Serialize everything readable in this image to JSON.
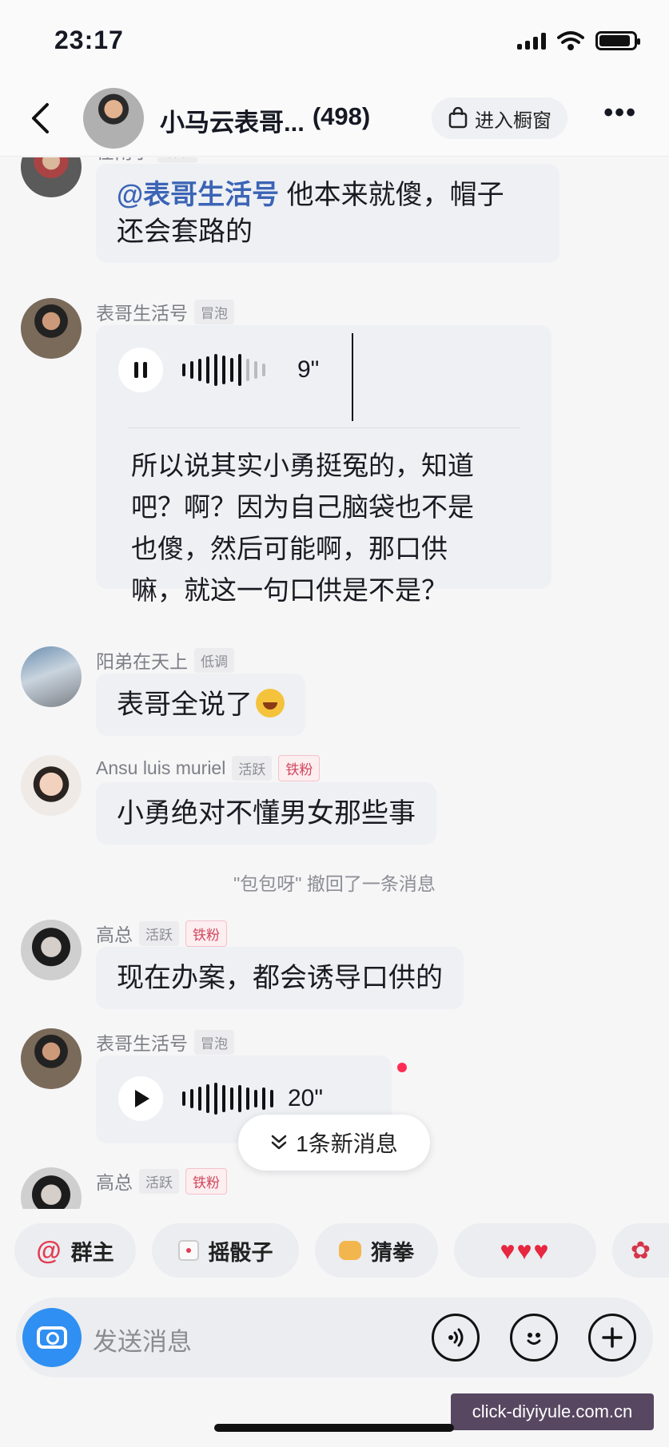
{
  "status_bar": {
    "time": "23:17"
  },
  "header": {
    "title": "小马云表哥...",
    "member_count": "(498)",
    "shop_label": "进入橱窗"
  },
  "messages": [
    {
      "name": "在南宁",
      "tags": [
        "活跃"
      ],
      "mention": "@表哥生活号",
      "text_line1": "他本来就傻，帽子",
      "text_line2": "还会套路的"
    },
    {
      "name": "表哥生活号",
      "tags": [
        "冒泡"
      ],
      "voice_duration": "9\"",
      "transcript": [
        "所以说其实小勇挺冤的，知道",
        "吧？啊？因为自己脑袋也不是",
        "也傻，然后可能啊，那口供",
        "嘛，就这一句口供是不是？"
      ]
    },
    {
      "name": "阳弟在天上",
      "tags": [
        "低调"
      ],
      "text": "表哥全说了"
    },
    {
      "name": "Ansu luis muriel",
      "tags": [
        "活跃",
        "铁粉"
      ],
      "text": "小勇绝对不懂男女那些事"
    },
    {
      "name": "高总",
      "tags": [
        "活跃",
        "铁粉"
      ],
      "text": "现在办案，都会诱导口供的"
    },
    {
      "name": "表哥生活号",
      "tags": [
        "冒泡"
      ],
      "voice_duration": "20\""
    },
    {
      "name": "高总",
      "tags": [
        "活跃",
        "铁粉"
      ]
    }
  ],
  "recall_notice": "\"包包呀\" 撤回了一条消息",
  "new_messages_label": "1条新消息",
  "quick_actions": [
    "群主",
    "摇骰子",
    "猜拳"
  ],
  "input": {
    "placeholder": "发送消息"
  },
  "watermark": "click-diyiyule.com.cn",
  "colors": {
    "accent_red": "#fe2c55",
    "mention_blue": "#3b64b5",
    "camera_blue": "#2f8ff2",
    "fan_tag": "#d0475c"
  }
}
